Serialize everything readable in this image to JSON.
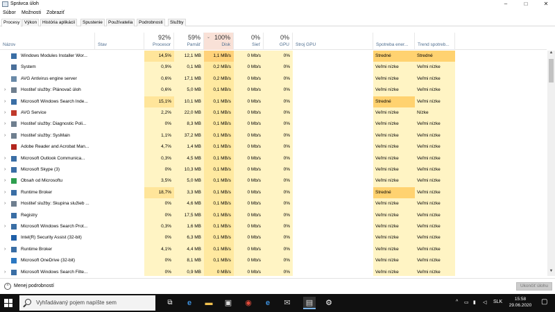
{
  "window": {
    "title": "Správca úloh",
    "minimize": "–",
    "maximize": "□",
    "close": "✕"
  },
  "menu": [
    "Súbor",
    "Možnosti",
    "Zobraziť"
  ],
  "tabs": [
    "Procesy",
    "Výkon",
    "História aplikácií",
    "Spustenie",
    "Používatelia",
    "Podrobnosti",
    "Služby"
  ],
  "columns": {
    "name": "Názov",
    "status": "Stav",
    "cpu": {
      "pct": "92%",
      "label": "Procesor"
    },
    "memory": {
      "pct": "59%",
      "label": "Pamäť"
    },
    "disk": {
      "pct": "100%",
      "label": "Disk"
    },
    "network": {
      "pct": "0%",
      "label": "Sieť"
    },
    "gpu": {
      "pct": "0%",
      "label": "GPU"
    },
    "gpu_engine": "Stroj GPU",
    "power": "Spotreba ener...",
    "power_trend": "Trend spotreb..."
  },
  "rows": [
    {
      "exp": "",
      "icon": "installer-icon",
      "icolor": "#3a6ea5",
      "name": "Windows Modules Installer Wor...",
      "cpu": "14,5%",
      "mem": "12,1 MB",
      "disk": "1,1 MB/s",
      "net": "0 Mb/s",
      "gpu": "0%",
      "power": "Stredné",
      "trend": "Stredné",
      "hc": true,
      "hd": true,
      "hp": true,
      "ht": true
    },
    {
      "exp": "",
      "icon": "system-icon",
      "icolor": "#4a6f9a",
      "name": "System",
      "cpu": "0,9%",
      "mem": "0,1 MB",
      "disk": "0,2 MB/s",
      "net": "0 Mb/s",
      "gpu": "0%",
      "power": "Veľmi nízke",
      "trend": "Veľmi nízke"
    },
    {
      "exp": "",
      "icon": "avg-icon",
      "icolor": "#6a8aa8",
      "name": "AVG Antivirus engine server",
      "cpu": "0,6%",
      "mem": "17,1 MB",
      "disk": "0,2 MB/s",
      "net": "0 Mb/s",
      "gpu": "0%",
      "power": "Veľmi nízke",
      "trend": "Veľmi nízke"
    },
    {
      "exp": "›",
      "icon": "gear-icon",
      "icolor": "#6f7f8f",
      "name": "Hostiteľ služby: Plánovač úloh",
      "cpu": "0,6%",
      "mem": "5,0 MB",
      "disk": "0,1 MB/s",
      "net": "0 Mb/s",
      "gpu": "0%",
      "power": "Veľmi nízke",
      "trend": "Veľmi nízke"
    },
    {
      "exp": "›",
      "icon": "search-service-icon",
      "icolor": "#3a6ea5",
      "name": "Microsoft Windows Search Inde...",
      "cpu": "15,1%",
      "mem": "10,1 MB",
      "disk": "0,1 MB/s",
      "net": "0 Mb/s",
      "gpu": "0%",
      "power": "Stredné",
      "trend": "Veľmi nízke",
      "hc": true,
      "hp": true
    },
    {
      "exp": "›",
      "icon": "avg-service-icon",
      "icolor": "#c0392b",
      "name": "AVG Service",
      "cpu": "2,2%",
      "mem": "22,0 MB",
      "disk": "0,1 MB/s",
      "net": "0 Mb/s",
      "gpu": "0%",
      "power": "Veľmi nízke",
      "trend": "Nízke"
    },
    {
      "exp": "›",
      "icon": "gear-icon",
      "icolor": "#6f7f8f",
      "name": "Hostiteľ služby: Diagnostic Poli...",
      "cpu": "0%",
      "mem": "8,3 MB",
      "disk": "0,1 MB/s",
      "net": "0 Mb/s",
      "gpu": "0%",
      "power": "Veľmi nízke",
      "trend": "Veľmi nízke"
    },
    {
      "exp": "›",
      "icon": "gear-icon",
      "icolor": "#6f7f8f",
      "name": "Hostiteľ služby: SysMain",
      "cpu": "1,1%",
      "mem": "37,2 MB",
      "disk": "0,1 MB/s",
      "net": "0 Mb/s",
      "gpu": "0%",
      "power": "Veľmi nízke",
      "trend": "Veľmi nízke"
    },
    {
      "exp": "",
      "icon": "adobe-icon",
      "icolor": "#b3261e",
      "name": "Adobe Reader and Acrobat Man...",
      "cpu": "4,7%",
      "mem": "1,4 MB",
      "disk": "0,1 MB/s",
      "net": "0 Mb/s",
      "gpu": "0%",
      "power": "Veľmi nízke",
      "trend": "Veľmi nízke"
    },
    {
      "exp": "›",
      "icon": "outlook-icon",
      "icolor": "#3a6ea5",
      "name": "Microsoft Outlook Communica...",
      "cpu": "0,3%",
      "mem": "4,5 MB",
      "disk": "0,1 MB/s",
      "net": "0 Mb/s",
      "gpu": "0%",
      "power": "Veľmi nízke",
      "trend": "Veľmi nízke"
    },
    {
      "exp": "›",
      "icon": "skype-icon",
      "icolor": "#3a6ea5",
      "name": "Microsoft Skype (3)",
      "cpu": "0%",
      "mem": "10,3 MB",
      "disk": "0,1 MB/s",
      "net": "0 Mb/s",
      "gpu": "0%",
      "power": "Veľmi nízke",
      "trend": "Veľmi nízke"
    },
    {
      "exp": "›",
      "icon": "store-icon",
      "icolor": "#2e9e4f",
      "name": "Obsah od Microsoftu",
      "cpu": "3,5%",
      "mem": "5,0 MB",
      "disk": "0,1 MB/s",
      "net": "0 Mb/s",
      "gpu": "0%",
      "power": "Veľmi nízke",
      "trend": "Veľmi nízke"
    },
    {
      "exp": "›",
      "icon": "runtime-broker-icon",
      "icolor": "#3a6ea5",
      "name": "Runtime Broker",
      "cpu": "18,7%",
      "mem": "3,3 MB",
      "disk": "0,1 MB/s",
      "net": "0 Mb/s",
      "gpu": "0%",
      "power": "Stredné",
      "trend": "Veľmi nízke",
      "hc": true,
      "hp": true
    },
    {
      "exp": "›",
      "icon": "gear-icon",
      "icolor": "#6f7f8f",
      "name": "Hostiteľ služby: Skupina služieb ...",
      "cpu": "0%",
      "mem": "4,6 MB",
      "disk": "0,1 MB/s",
      "net": "0 Mb/s",
      "gpu": "0%",
      "power": "Veľmi nízke",
      "trend": "Veľmi nízke"
    },
    {
      "exp": "",
      "icon": "registry-icon",
      "icolor": "#3a6ea5",
      "name": "Registry",
      "cpu": "0%",
      "mem": "17,5 MB",
      "disk": "0,1 MB/s",
      "net": "0 Mb/s",
      "gpu": "0%",
      "power": "Veľmi nízke",
      "trend": "Veľmi nízke"
    },
    {
      "exp": "›",
      "icon": "search-service-icon",
      "icolor": "#3a6ea5",
      "name": "Microsoft Windows Search Prot...",
      "cpu": "0,3%",
      "mem": "1,6 MB",
      "disk": "0,1 MB/s",
      "net": "0 Mb/s",
      "gpu": "0%",
      "power": "Veľmi nízke",
      "trend": "Veľmi nízke"
    },
    {
      "exp": "",
      "icon": "intel-icon",
      "icolor": "#1f5fa8",
      "name": "Intel(R) Security Assist (32-bit)",
      "cpu": "0%",
      "mem": "6,3 MB",
      "disk": "0,1 MB/s",
      "net": "0 Mb/s",
      "gpu": "0%",
      "power": "Veľmi nízke",
      "trend": "Veľmi nízke"
    },
    {
      "exp": "›",
      "icon": "runtime-broker-icon",
      "icolor": "#3a6ea5",
      "name": "Runtime Broker",
      "cpu": "4,1%",
      "mem": "4,4 MB",
      "disk": "0,1 MB/s",
      "net": "0 Mb/s",
      "gpu": "0%",
      "power": "Veľmi nízke",
      "trend": "Veľmi nízke"
    },
    {
      "exp": "",
      "icon": "onedrive-icon",
      "icolor": "#2b78c2",
      "name": "Microsoft OneDrive (32-bit)",
      "cpu": "0%",
      "mem": "8,1 MB",
      "disk": "0,1 MB/s",
      "net": "0 Mb/s",
      "gpu": "0%",
      "power": "Veľmi nízke",
      "trend": "Veľmi nízke"
    },
    {
      "exp": "›",
      "icon": "search-service-icon",
      "icolor": "#3a6ea5",
      "name": "Microsoft Windows Search Filte...",
      "cpu": "0%",
      "mem": "0,9 MB",
      "disk": "0 MB/s",
      "net": "0 Mb/s",
      "gpu": "0%",
      "power": "Veľmi nízke",
      "trend": "Veľmi nízke"
    }
  ],
  "footer": {
    "fewer_details": "Menej podrobností",
    "end_task": "Ukončiť úlohu"
  },
  "taskbar": {
    "search_placeholder": "Vyhľadávaný pojem napíšte sem",
    "language": "SLK",
    "time": "15:58",
    "date": "29.06.2020",
    "tray_chevron": "^"
  },
  "colors": {
    "heat_light": "#fff4c4",
    "heat_medium": "#ffe59a",
    "heat_disk": "#ffd27a",
    "heat_power": "#ffd270",
    "taskbar": "#101010"
  }
}
